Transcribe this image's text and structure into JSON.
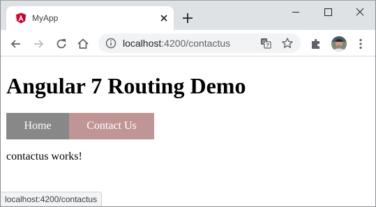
{
  "browser": {
    "tab": {
      "title": "MyApp",
      "favicon": "angular-logo-icon"
    },
    "toolbar": {
      "url_host": "localhost",
      "url_path": ":4200/contactus",
      "icons": [
        "back-arrow-icon",
        "forward-arrow-icon",
        "reload-icon",
        "home-icon",
        "info-icon",
        "translate-icon",
        "star-icon",
        "extensions-icon",
        "avatar",
        "menu-icon"
      ]
    },
    "status_url": "localhost:4200/contactus",
    "colors": {
      "tabstrip": "#dee1e6",
      "angular_red": "#dd0031"
    }
  },
  "page": {
    "title": "Angular 7 Routing Demo",
    "nav": [
      {
        "label": "Home",
        "color": "#888888"
      },
      {
        "label": "Contact Us",
        "color": "#c09595"
      }
    ],
    "content": "contactus works!"
  }
}
